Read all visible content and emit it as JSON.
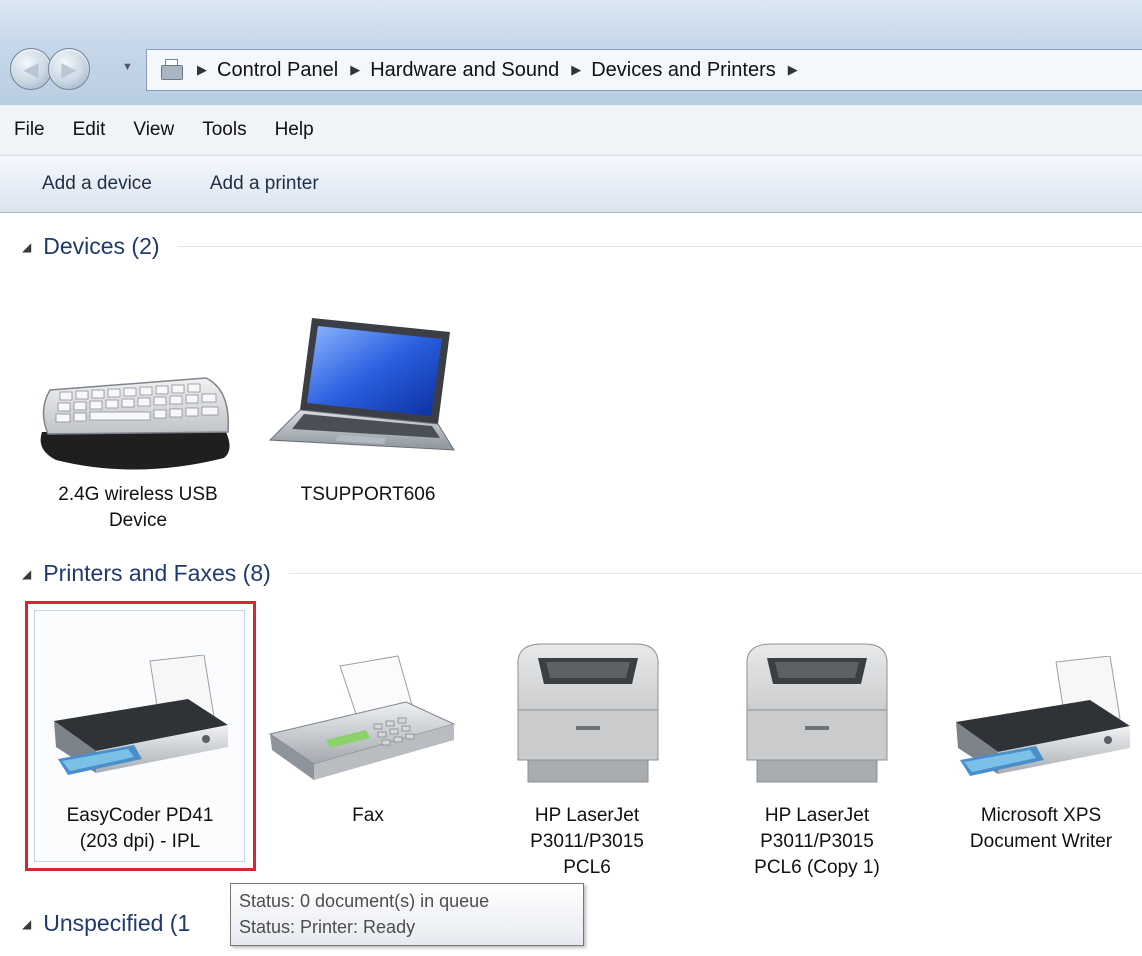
{
  "breadcrumb": {
    "items": [
      "Control Panel",
      "Hardware and Sound",
      "Devices and Printers"
    ]
  },
  "menu": [
    "File",
    "Edit",
    "View",
    "Tools",
    "Help"
  ],
  "toolbar": {
    "add_device": "Add a device",
    "add_printer": "Add a printer"
  },
  "groups": {
    "devices": {
      "title": "Devices (2)",
      "items": [
        {
          "line1": "2.4G wireless USB",
          "line2": "Device",
          "icon": "keyboard-icon"
        },
        {
          "line1": "TSUPPORT606",
          "line2": "",
          "icon": "laptop-icon"
        }
      ]
    },
    "printers": {
      "title": "Printers and Faxes (8)",
      "items": [
        {
          "line1": "EasyCoder PD41",
          "line2": "(203 dpi) - IPL",
          "line3": "",
          "icon": "printer-icon",
          "selected": true
        },
        {
          "line1": "Fax",
          "line2": "",
          "line3": "",
          "icon": "fax-icon"
        },
        {
          "line1": "HP LaserJet",
          "line2": "P3011/P3015",
          "line3": "PCL6",
          "icon": "laser-printer-icon"
        },
        {
          "line1": "HP LaserJet",
          "line2": "P3011/P3015",
          "line3": "PCL6 (Copy 1)",
          "icon": "laser-printer-icon"
        },
        {
          "line1": "Microsoft XPS",
          "line2": "Document Writer",
          "line3": "",
          "icon": "printer-icon"
        }
      ]
    },
    "unspecified": {
      "title": "Unspecified (1"
    }
  },
  "tooltip": {
    "line1": "Status: 0 document(s) in queue",
    "line2": "Status: Printer:  Ready"
  },
  "colors": {
    "selection_border": "#d6262e",
    "group_title": "#1e3a6e"
  }
}
